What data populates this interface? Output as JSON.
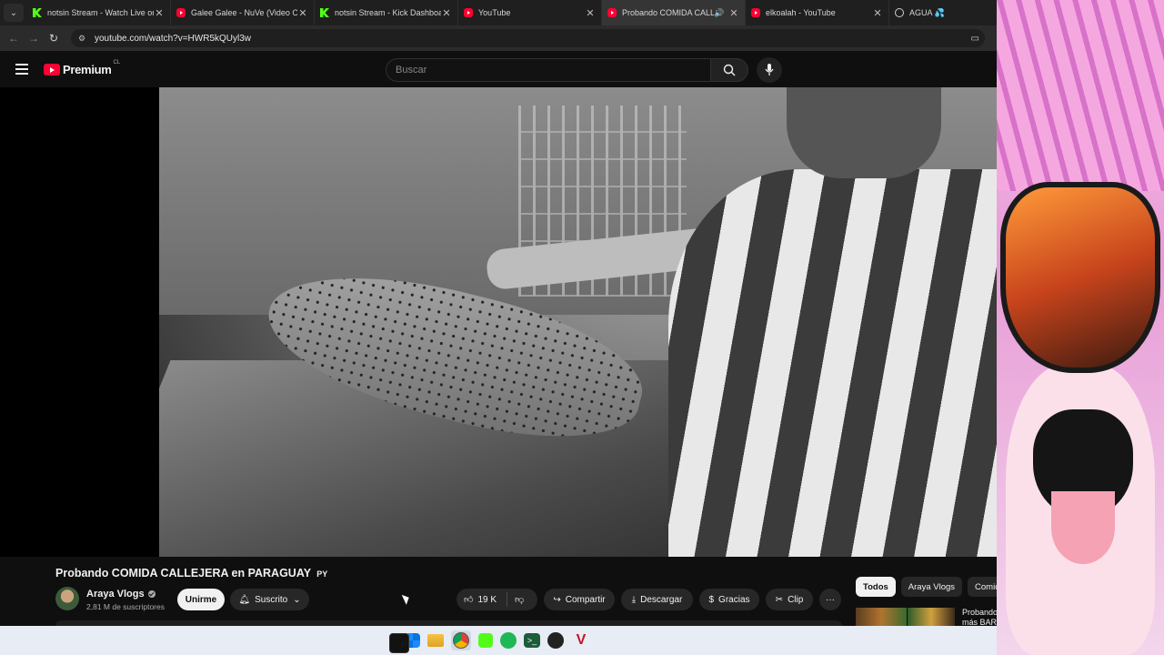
{
  "browser": {
    "tabs": [
      {
        "title": "notsin Stream - Watch Live on K",
        "icon": "kick-icon",
        "active": false
      },
      {
        "title": "Galee Galee - NuVe (Video Ofic",
        "icon": "youtube-icon",
        "active": false
      },
      {
        "title": "notsin Stream - Kick Dashboard",
        "icon": "kick-icon",
        "active": false
      },
      {
        "title": "YouTube",
        "icon": "youtube-icon",
        "active": false
      },
      {
        "title": "Probando COMIDA CALLEJERA",
        "icon": "youtube-icon",
        "active": true
      },
      {
        "title": "elkoalah - YouTube",
        "icon": "youtube-icon",
        "active": false
      },
      {
        "title": "AGUA 💦",
        "icon": "globe-icon",
        "active": false
      }
    ],
    "url": "youtube.com/watch?v=HWR5kQUyl3w"
  },
  "youtube": {
    "logo_text": "Premium",
    "country_code": "CL",
    "search_placeholder": "Buscar"
  },
  "video": {
    "title": "Probando COMIDA CALLEJERA en PARAGUAY",
    "flag_text": "PY",
    "channel": "Araya Vlogs",
    "subscribers": "2,81 M de suscriptores",
    "join_label": "Unirme",
    "subscribed_label": "Suscrito",
    "likes": "19 K",
    "share_label": "Compartir",
    "download_label": "Descargar",
    "thanks_label": "Gracias",
    "clip_label": "Clip",
    "more_label": "···"
  },
  "sidebar": {
    "chips": [
      "Todos",
      "Araya Vlogs",
      "Comida"
    ],
    "reco_title_line1": "Probando",
    "reco_title_line2": "más BAR"
  },
  "colors": {
    "accent": "#ff0033",
    "background": "#0f0f0f",
    "kick_green": "#53fc18"
  }
}
